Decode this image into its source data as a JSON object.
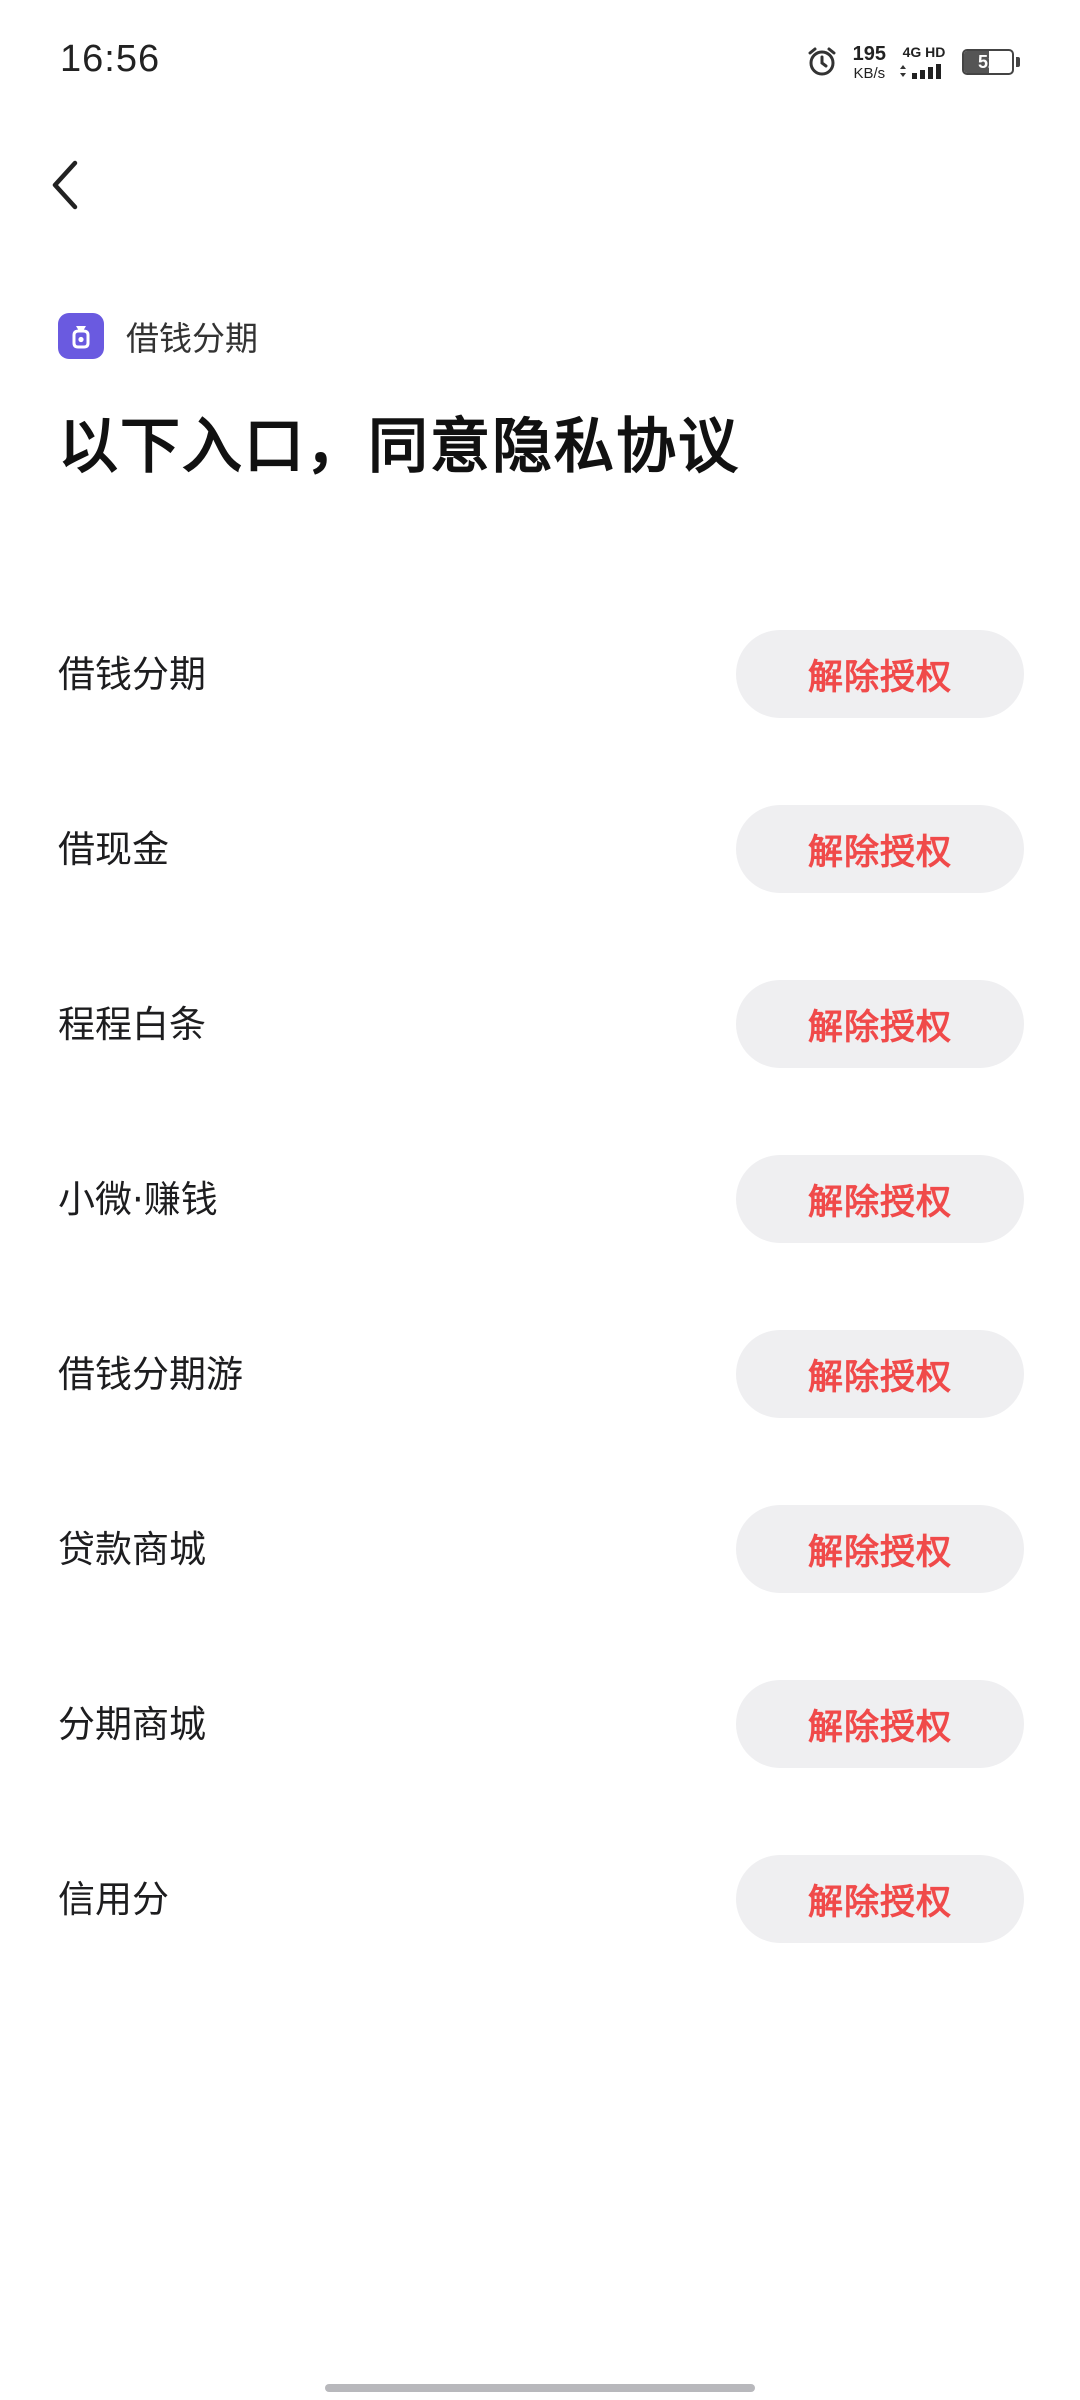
{
  "status_bar": {
    "time": "16:56",
    "net_speed_value": "195",
    "net_speed_unit": "KB/s",
    "network_label": "4G HD",
    "battery_level": "52"
  },
  "header": {
    "back_icon": "chevron-left-icon",
    "app_icon": "money-bag-icon",
    "app_name": "借钱分期",
    "title": "以下入口，同意隐私协议"
  },
  "items": [
    {
      "label": "借钱分期",
      "button": "解除授权"
    },
    {
      "label": "借现金",
      "button": "解除授权"
    },
    {
      "label": "程程白条",
      "button": "解除授权"
    },
    {
      "label": "小微·赚钱",
      "button": "解除授权"
    },
    {
      "label": "借钱分期游",
      "button": "解除授权"
    },
    {
      "label": "贷款商城",
      "button": "解除授权"
    },
    {
      "label": "分期商城",
      "button": "解除授权"
    },
    {
      "label": "信用分",
      "button": "解除授权"
    }
  ],
  "colors": {
    "accent_red": "#f04a4a",
    "app_icon_purple": "#6a5ae0",
    "button_bg": "#efeff1"
  }
}
